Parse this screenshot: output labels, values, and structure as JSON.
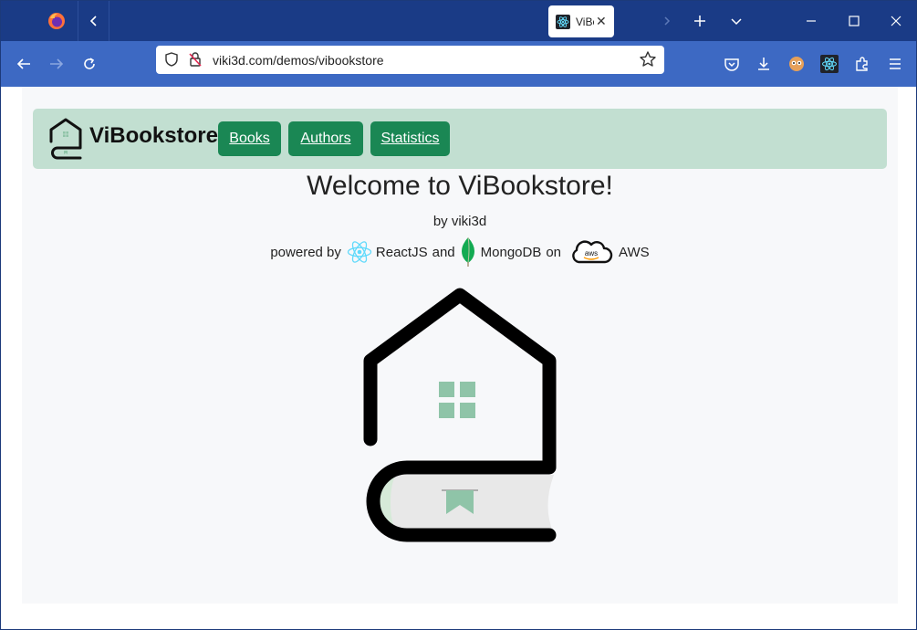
{
  "browser": {
    "tab": {
      "title": "ViBookstore",
      "close": "✕"
    },
    "url": "viki3d.com/demos/vibookstore"
  },
  "nav": {
    "brand": "ViBookstore",
    "links": [
      "Books",
      "Authors",
      "Statistics"
    ]
  },
  "hero": {
    "title": "Welcome to ViBookstore!",
    "byline": "by viki3d",
    "powered_prefix": "powered by",
    "tech_react": "ReactJS",
    "and": "and",
    "tech_mongo": "MongoDB",
    "on": "on",
    "tech_aws": "AWS"
  },
  "icons": {
    "firefox": "firefox-icon",
    "react": "react-icon",
    "mongodb": "mongodb-icon",
    "aws": "aws-icon"
  },
  "colors": {
    "tabstrip": "#1a3b86",
    "toolbar": "#3d69c3",
    "navbar": "#c2dfd1",
    "nav_button": "#1a8754",
    "logo_green": "#8fc4a8"
  }
}
